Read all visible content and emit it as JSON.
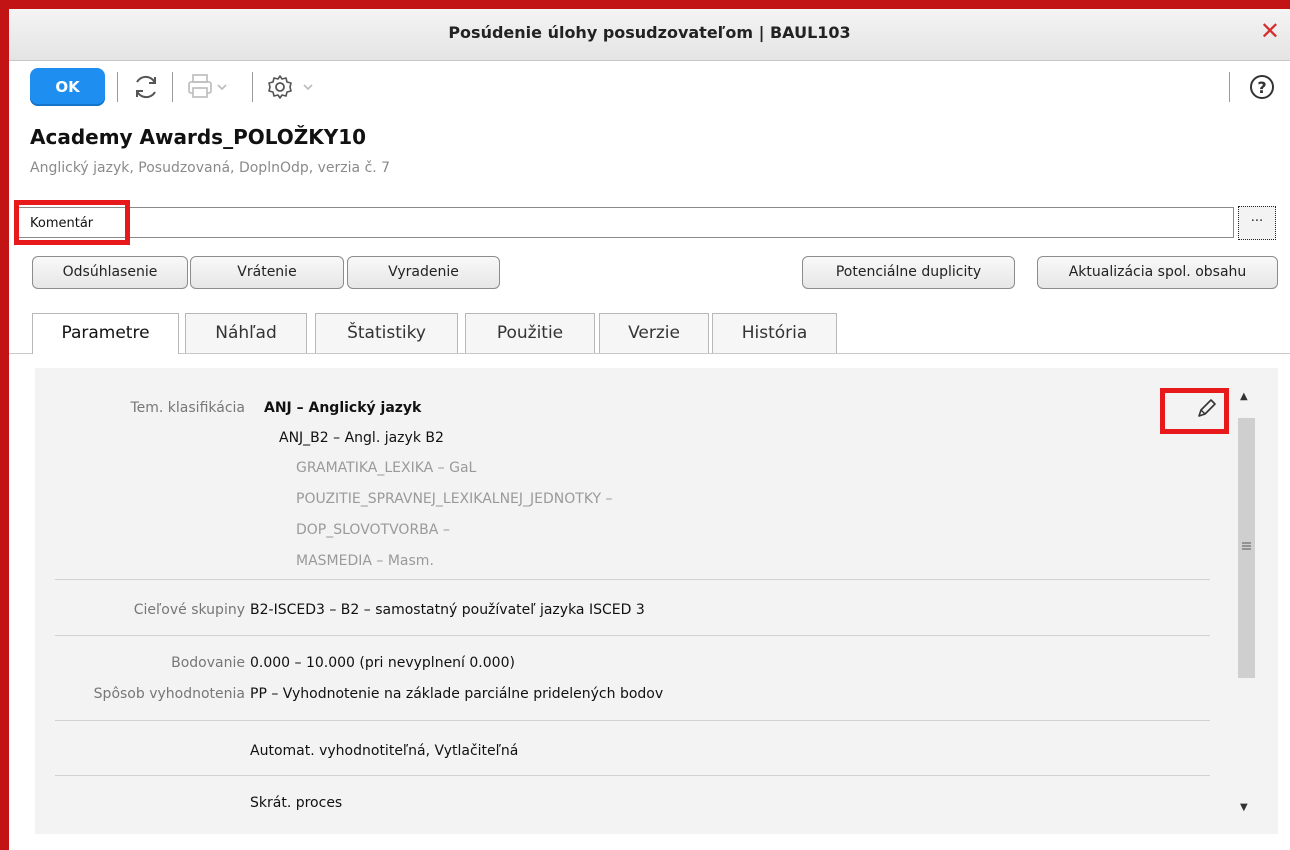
{
  "window": {
    "title": "Posúdenie úlohy posudzovateľom | BAUL103",
    "close": "✕"
  },
  "toolbar": {
    "ok_label": "OK"
  },
  "item": {
    "title": "Academy Awards_POLOŽKY10",
    "subtitle": "Anglický jazyk, Posudzovaná, DoplnOdp, verzia č. 7"
  },
  "comment": {
    "label": "Komentár",
    "value": "",
    "ellipsis": "···"
  },
  "actions": {
    "approve": "Odsúhlasenie",
    "return": "Vrátenie",
    "discard": "Vyradenie",
    "duplicates": "Potenciálne duplicity",
    "update_shared": "Aktualizácia spol. obsahu"
  },
  "tabs": [
    {
      "label": "Parametre",
      "active": true
    },
    {
      "label": "Náhľad",
      "active": false
    },
    {
      "label": "Štatistiky",
      "active": false
    },
    {
      "label": "Použitie",
      "active": false
    },
    {
      "label": "Verzie",
      "active": false
    },
    {
      "label": "História",
      "active": false
    }
  ],
  "params": {
    "classification": {
      "label": "Tem. klasifikácia",
      "level1": "ANJ – Anglický jazyk",
      "level2": "ANJ_B2 – Angl. jazyk B2",
      "level3": [
        "GRAMATIKA_LEXIKA – GaL",
        "POUZITIE_SPRAVNEJ_LEXIKALNEJ_JEDNOTKY –",
        "DOP_SLOVOTVORBA –",
        "MASMEDIA – Masm."
      ]
    },
    "target_groups": {
      "label": "Cieľové skupiny",
      "value": "B2-ISCED3 – B2 – samostatný používateľ jazyka ISCED 3"
    },
    "scoring": {
      "label": "Bodovanie",
      "value": "0.000 – 10.000 (pri nevyplnení 0.000)"
    },
    "evaluation": {
      "label": "Spôsob vyhodnotenia",
      "value": "PP – Vyhodnotenie na základe parciálne pridelených bodov"
    },
    "flags": "Automat. vyhodnotiteľná, Vytlačiteľná",
    "process": "Skrát. proces"
  },
  "colors": {
    "ok": "#1e8ff0",
    "highlight": "#e8191b",
    "close": "#d43030"
  },
  "icons": [
    "refresh-icon",
    "print-icon",
    "gear-icon",
    "help-icon",
    "pencil-icon"
  ]
}
